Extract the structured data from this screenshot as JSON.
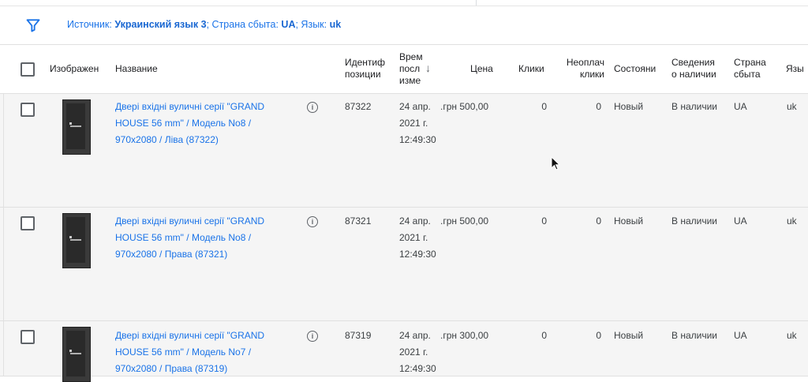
{
  "filter": {
    "source_label": "Источник: ",
    "source_value": "Украинский язык 3",
    "country_label": "; Страна сбыта: ",
    "country_value": "UA",
    "language_label": "; Язык: ",
    "language_value": "uk"
  },
  "columns": {
    "image": "Изображен",
    "name": "Название",
    "item_id": "Идентиф\nпозиции",
    "updated": "Врем\nпосл\nизме",
    "price": "Цена",
    "clicks": "Клики",
    "unpaid_clicks": "Неоплач\nклики",
    "status": "Состояни",
    "availability": "Сведения\nо наличии",
    "country": "Страна\nсбыта",
    "language": "Язы"
  },
  "sort_indicator": "↓",
  "rows": [
    {
      "name": "Двері вхідні вуличні серії \"GRAND HOUSE 56 mm\" / Модель No8 / 970x2080 / Ліва (87322)",
      "item_id": "87322",
      "date_line1": "24 апр.",
      "date_line2": "2021 г.",
      "date_line3": "12:49:30",
      "price": "500,00 грн.",
      "clicks": "0",
      "unpaid_clicks": "0",
      "status": "Новый",
      "availability": "В наличии",
      "country": "UA",
      "language": "uk"
    },
    {
      "name": "Двері вхідні вуличні серії \"GRAND HOUSE 56 mm\" / Модель No8 / 970x2080 / Права (87321)",
      "item_id": "87321",
      "date_line1": "24 апр.",
      "date_line2": "2021 г.",
      "date_line3": "12:49:30",
      "price": "500,00 грн.",
      "clicks": "0",
      "unpaid_clicks": "0",
      "status": "Новый",
      "availability": "В наличии",
      "country": "UA",
      "language": "uk"
    },
    {
      "name": "Двері вхідні вуличні серії \"GRAND HOUSE 56 mm\" / Модель No7 / 970x2080 / Права (87319)",
      "item_id": "87319",
      "date_line1": "24 апр.",
      "date_line2": "2021 г.",
      "date_line3": "12:49:30",
      "price": "300,00 грн.",
      "clicks": "0",
      "unpaid_clicks": "0",
      "status": "Новый",
      "availability": "В наличии",
      "country": "UA",
      "language": "uk"
    }
  ],
  "icons": {
    "filter": "filter-icon",
    "info": "info-icon",
    "sort": "arrow-down-icon",
    "cursor": "mouse-pointer-icon"
  },
  "colors": {
    "link": "#1a73e8",
    "row_background": "#f5f5f5",
    "header_background": "#ffffff"
  }
}
